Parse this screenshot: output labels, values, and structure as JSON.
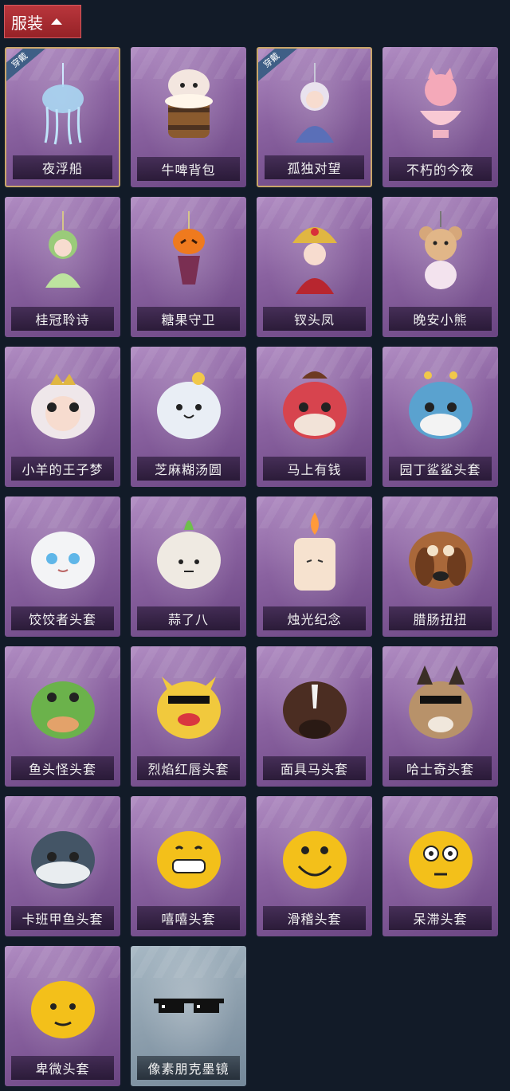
{
  "header": {
    "label": "服装"
  },
  "badge_text": "穿戴",
  "items": [
    {
      "name": "夜浮船",
      "worn": true,
      "icon": "jellyfish-pendant-icon"
    },
    {
      "name": "牛啤背包",
      "worn": false,
      "icon": "beer-barrel-cow-icon"
    },
    {
      "name": "孤独对望",
      "worn": true,
      "icon": "doll-pendant-icon"
    },
    {
      "name": "不朽的今夜",
      "worn": false,
      "icon": "pink-cat-bowl-icon"
    },
    {
      "name": "桂冠聆诗",
      "worn": false,
      "icon": "laurel-doll-icon"
    },
    {
      "name": "糖果守卫",
      "worn": false,
      "icon": "pumpkin-guard-icon"
    },
    {
      "name": "钗头凤",
      "worn": false,
      "icon": "phoenix-crown-doll-icon"
    },
    {
      "name": "晚安小熊",
      "worn": false,
      "icon": "teddy-bear-icon"
    },
    {
      "name": "小羊的王子梦",
      "worn": false,
      "icon": "sheep-prince-icon"
    },
    {
      "name": "芝麻糊汤圆",
      "worn": false,
      "icon": "rice-ball-icon"
    },
    {
      "name": "马上有钱",
      "worn": false,
      "icon": "red-horse-head-icon"
    },
    {
      "name": "园丁鲨鲨头套",
      "worn": false,
      "icon": "shark-head-icon"
    },
    {
      "name": "饺饺者头套",
      "worn": false,
      "icon": "dumpling-head-icon"
    },
    {
      "name": "蒜了八",
      "worn": false,
      "icon": "garlic-head-icon"
    },
    {
      "name": "烛光纪念",
      "worn": false,
      "icon": "candle-head-icon"
    },
    {
      "name": "腊肠扭扭",
      "worn": false,
      "icon": "dachshund-head-icon"
    },
    {
      "name": "鱼头怪头套",
      "worn": false,
      "icon": "fish-head-icon"
    },
    {
      "name": "烈焰红唇头套",
      "worn": false,
      "icon": "yellow-mouse-head-icon"
    },
    {
      "name": "面具马头套",
      "worn": false,
      "icon": "horse-mask-icon"
    },
    {
      "name": "哈士奇头套",
      "worn": false,
      "icon": "husky-head-icon"
    },
    {
      "name": "卡班甲鱼头套",
      "worn": false,
      "icon": "whale-head-icon"
    },
    {
      "name": "嘻嘻头套",
      "worn": false,
      "icon": "grin-emoji-icon"
    },
    {
      "name": "滑稽头套",
      "worn": false,
      "icon": "smirk-emoji-icon"
    },
    {
      "name": "呆滞头套",
      "worn": false,
      "icon": "dazed-emoji-icon"
    },
    {
      "name": "卑微头套",
      "worn": false,
      "icon": "humble-emoji-icon"
    },
    {
      "name": "像素朋克墨镜",
      "worn": false,
      "icon": "pixel-sunglasses-icon",
      "grey": true
    }
  ]
}
